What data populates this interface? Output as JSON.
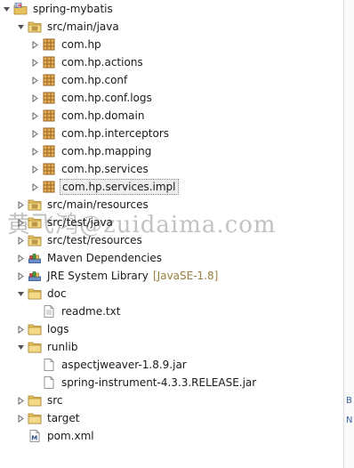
{
  "tree": {
    "items": [
      {
        "label": "spring-mybatis",
        "icon": "java-project-icon",
        "expanded": true,
        "depth": 0
      },
      {
        "label": "src/main/java",
        "icon": "source-folder-icon",
        "expanded": true,
        "depth": 1
      },
      {
        "label": "com.hp",
        "icon": "package-icon",
        "expanded": false,
        "depth": 2
      },
      {
        "label": "com.hp.actions",
        "icon": "package-icon",
        "expanded": false,
        "depth": 2
      },
      {
        "label": "com.hp.conf",
        "icon": "package-icon",
        "expanded": false,
        "depth": 2
      },
      {
        "label": "com.hp.conf.logs",
        "icon": "package-icon",
        "expanded": false,
        "depth": 2
      },
      {
        "label": "com.hp.domain",
        "icon": "package-icon",
        "expanded": false,
        "depth": 2
      },
      {
        "label": "com.hp.interceptors",
        "icon": "package-icon",
        "expanded": false,
        "depth": 2
      },
      {
        "label": "com.hp.mapping",
        "icon": "package-icon",
        "expanded": false,
        "depth": 2
      },
      {
        "label": "com.hp.services",
        "icon": "package-icon",
        "expanded": false,
        "depth": 2
      },
      {
        "label": "com.hp.services.impl",
        "icon": "package-icon",
        "expanded": false,
        "depth": 2,
        "selected": true
      },
      {
        "label": "src/main/resources",
        "icon": "source-folder-icon",
        "expanded": false,
        "depth": 1
      },
      {
        "label": "src/test/java",
        "icon": "source-folder-icon",
        "expanded": false,
        "depth": 1
      },
      {
        "label": "src/test/resources",
        "icon": "source-folder-icon",
        "expanded": false,
        "depth": 1
      },
      {
        "label": "Maven Dependencies",
        "icon": "library-icon",
        "expanded": false,
        "depth": 1
      },
      {
        "label": "JRE System Library",
        "decoration": "[JavaSE-1.8]",
        "icon": "library-icon",
        "expanded": false,
        "depth": 1
      },
      {
        "label": "doc",
        "icon": "folder-icon",
        "expanded": true,
        "depth": 1
      },
      {
        "label": "readme.txt",
        "icon": "text-file-icon",
        "depth": 2
      },
      {
        "label": "logs",
        "icon": "folder-icon",
        "expanded": false,
        "depth": 1
      },
      {
        "label": "runlib",
        "icon": "folder-icon",
        "expanded": true,
        "depth": 1
      },
      {
        "label": "aspectjweaver-1.8.9.jar",
        "icon": "file-icon",
        "depth": 2
      },
      {
        "label": "spring-instrument-4.3.3.RELEASE.jar",
        "icon": "file-icon",
        "depth": 2
      },
      {
        "label": "src",
        "icon": "folder-icon",
        "expanded": false,
        "depth": 1
      },
      {
        "label": "target",
        "icon": "folder-icon",
        "expanded": false,
        "depth": 1
      },
      {
        "label": "pom.xml",
        "icon": "maven-pom-icon",
        "depth": 1
      }
    ]
  },
  "watermark": {
    "text": "黄飞鸿@zuidaima.com"
  },
  "right_edge": {
    "letters": [
      "B",
      "N"
    ]
  },
  "colors": {
    "package": "#b07d2b",
    "folder": "#e8c15a",
    "source_folder": "#d9a94a",
    "selection": "#eeeeee",
    "decoration": "#9a7e3a",
    "expand_arrow": "#555555"
  }
}
